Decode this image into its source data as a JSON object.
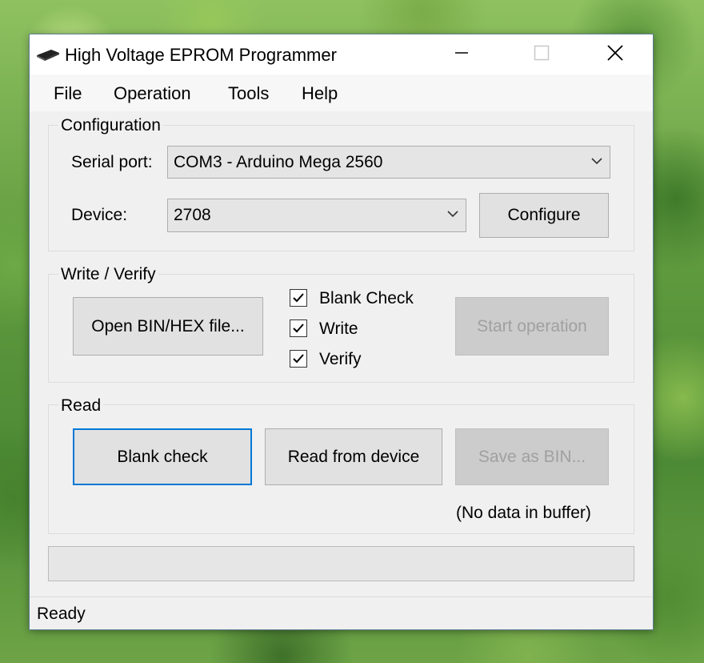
{
  "window": {
    "title": "High Voltage EPROM Programmer"
  },
  "menu": {
    "items": [
      "File",
      "Operation",
      "Tools",
      "Help"
    ]
  },
  "configuration": {
    "group_label": "Configuration",
    "serial_port_label": "Serial port:",
    "serial_port_value": "COM3 - Arduino Mega 2560",
    "device_label": "Device:",
    "device_value": "2708",
    "configure_button": "Configure"
  },
  "write_verify": {
    "group_label": "Write / Verify",
    "open_button": "Open BIN/HEX file...",
    "checks": [
      {
        "label": "Blank Check",
        "checked": true
      },
      {
        "label": "Write",
        "checked": true
      },
      {
        "label": "Verify",
        "checked": true
      }
    ],
    "start_button": "Start operation"
  },
  "read": {
    "group_label": "Read",
    "blank_check_button": "Blank check",
    "read_button": "Read from device",
    "save_button": "Save as BIN...",
    "buffer_status": "(No data in buffer)"
  },
  "progress": {
    "value": 0
  },
  "status": {
    "text": "Ready"
  },
  "colors": {
    "focus_accent": "#0078d7",
    "window_bg": "#f0f0f0",
    "disabled_text": "#a0a0a0"
  }
}
